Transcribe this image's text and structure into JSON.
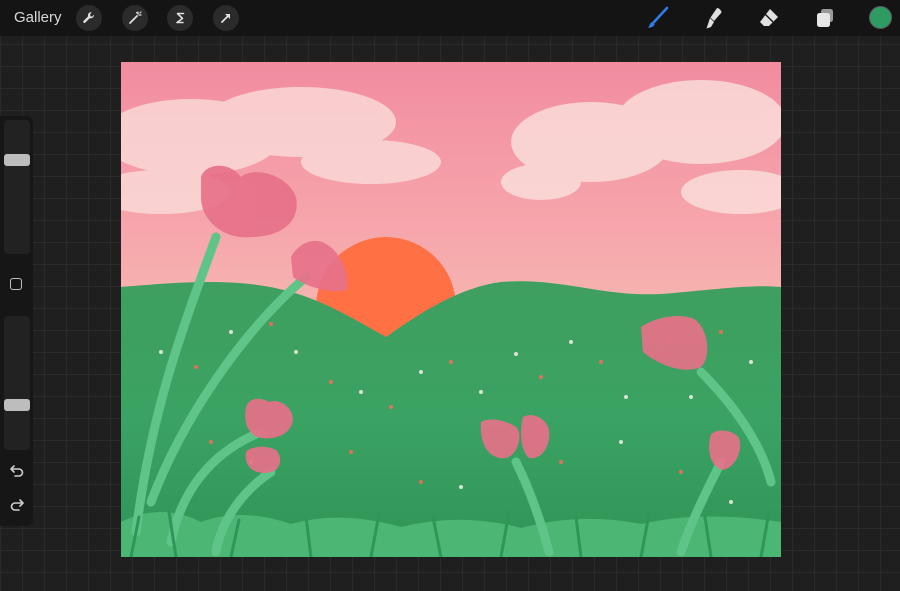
{
  "topbar": {
    "gallery_label": "Gallery",
    "left_tools": [
      "wrench-icon",
      "magic-wand-icon",
      "selection-icon",
      "transform-arrow-icon"
    ],
    "right_tools": [
      "brush-icon",
      "smudge-icon",
      "eraser-icon",
      "layers-icon"
    ],
    "active_tool": "brush-icon",
    "active_tool_color": "#2f7ee8",
    "current_color": "#2e9b63"
  },
  "sidebar": {
    "brush_size_level": 0.72,
    "opacity_level": 0.32,
    "controls": [
      "modify-button",
      "undo-icon",
      "redo-icon"
    ]
  },
  "canvas": {
    "palette": {
      "sky_top": "#f28ca0",
      "horizon": "#f5d2b6",
      "sun": "#ff7145",
      "grass": "#3fa866",
      "grass_dark": "#2d8e52",
      "tulip": "#e67189",
      "stem": "#5ec487"
    }
  }
}
